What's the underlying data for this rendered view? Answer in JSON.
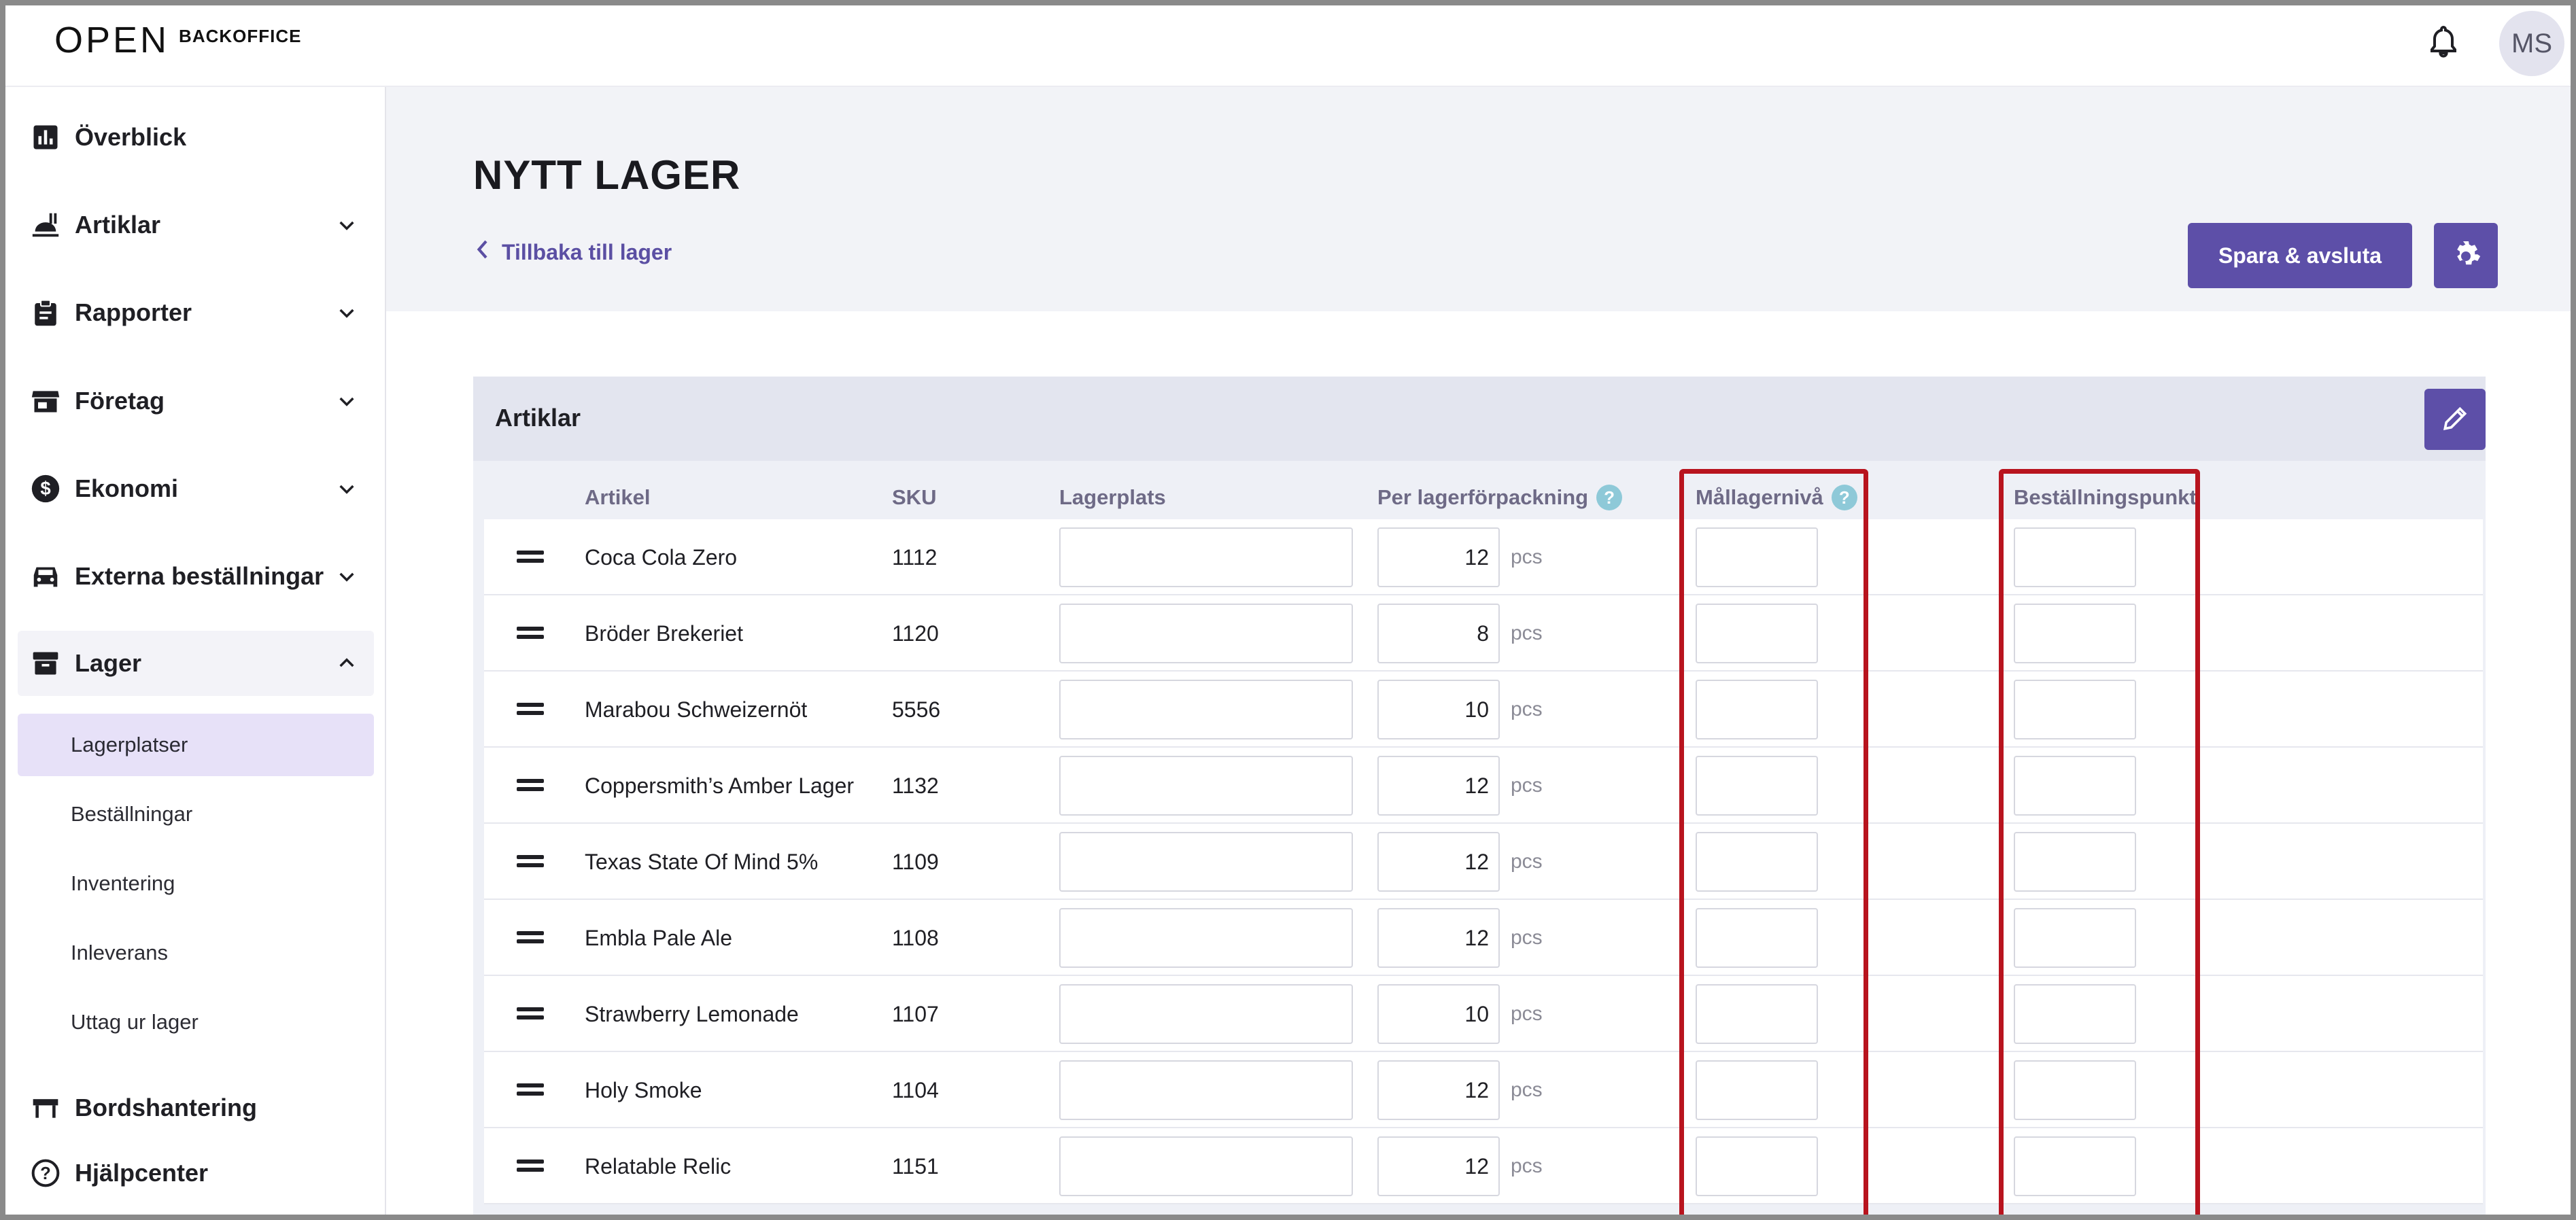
{
  "app": {
    "logo_mark": "OPEN",
    "logo_text": "BACKOFFICE",
    "user_initials": "MS"
  },
  "sidebar": {
    "items": [
      {
        "label": "Överblick",
        "icon": "bar-chart-icon",
        "expandable": false
      },
      {
        "label": "Artiklar",
        "icon": "food-icon",
        "expandable": true
      },
      {
        "label": "Rapporter",
        "icon": "clipboard-icon",
        "expandable": true
      },
      {
        "label": "Företag",
        "icon": "storefront-icon",
        "expandable": true
      },
      {
        "label": "Ekonomi",
        "icon": "dollar-icon",
        "expandable": true
      },
      {
        "label": "Externa beställningar",
        "icon": "car-icon",
        "expandable": true
      },
      {
        "label": "Lager",
        "icon": "archive-icon",
        "expandable": true,
        "expanded": true
      }
    ],
    "lager_subitems": [
      {
        "label": "Lagerplatser",
        "selected": true
      },
      {
        "label": "Beställningar"
      },
      {
        "label": "Inventering"
      },
      {
        "label": "Inleverans"
      },
      {
        "label": "Uttag ur lager"
      }
    ],
    "bottom_items": [
      {
        "label": "Bordshantering",
        "icon": "table-icon"
      },
      {
        "label": "Hjälpcenter",
        "icon": "help-circle-icon"
      }
    ]
  },
  "header": {
    "title": "NYTT LAGER",
    "back_label": "Tillbaka till lager",
    "save_label": "Spara & avsluta"
  },
  "panel": {
    "title": "Artiklar",
    "columns": {
      "artikel": "Artikel",
      "sku": "SKU",
      "lagerplats": "Lagerplats",
      "per_forpackning": "Per lagerförpackning",
      "mallagerniva": "Mållagernivå",
      "bestallningspunkt": "Beställningspunkt"
    },
    "help_glyph": "?",
    "unit": "pcs",
    "rows": [
      {
        "artikel": "Coca Cola Zero",
        "sku": "1112",
        "lagerplats": "",
        "per": "12",
        "mal": "",
        "best": ""
      },
      {
        "artikel": "Bröder Brekeriet",
        "sku": "1120",
        "lagerplats": "",
        "per": "8",
        "mal": "",
        "best": ""
      },
      {
        "artikel": "Marabou Schweizernöt",
        "sku": "5556",
        "lagerplats": "",
        "per": "10",
        "mal": "",
        "best": ""
      },
      {
        "artikel": "Coppersmith’s Amber Lager",
        "sku": "1132",
        "lagerplats": "",
        "per": "12",
        "mal": "",
        "best": ""
      },
      {
        "artikel": "Texas State Of Mind 5%",
        "sku": "1109",
        "lagerplats": "",
        "per": "12",
        "mal": "",
        "best": ""
      },
      {
        "artikel": "Embla Pale Ale",
        "sku": "1108",
        "lagerplats": "",
        "per": "12",
        "mal": "",
        "best": ""
      },
      {
        "artikel": "Strawberry Lemonade",
        "sku": "1107",
        "lagerplats": "",
        "per": "10",
        "mal": "",
        "best": ""
      },
      {
        "artikel": "Holy Smoke",
        "sku": "1104",
        "lagerplats": "",
        "per": "12",
        "mal": "",
        "best": ""
      },
      {
        "artikel": "Relatable Relic",
        "sku": "1151",
        "lagerplats": "",
        "per": "12",
        "mal": "",
        "best": ""
      }
    ]
  },
  "colors": {
    "accent": "#5d4fa8",
    "highlight": "#b8141e",
    "selected_bg": "#e7e1f8"
  }
}
